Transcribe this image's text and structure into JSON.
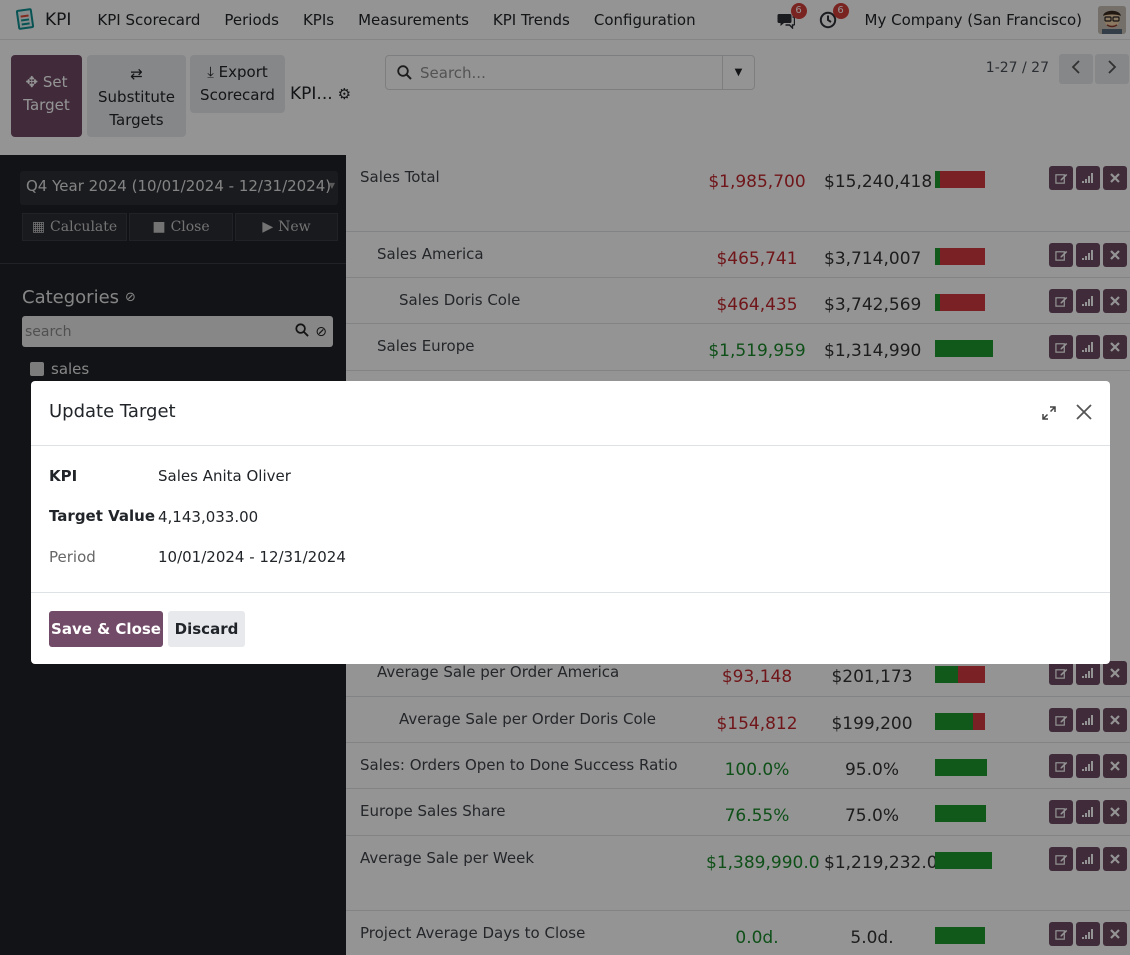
{
  "navbar": {
    "brand": "KPI",
    "menu": [
      "KPI Scorecard",
      "Periods",
      "KPIs",
      "Measurements",
      "KPI Trends",
      "Configuration"
    ],
    "messages_badge": "6",
    "activities_badge": "6",
    "company": "My Company (San Francisco)"
  },
  "control_panel": {
    "set_target_line1": "Set",
    "set_target_line2": "Target",
    "substitute_line1": "Substitute",
    "substitute_line2": "Targets",
    "export_line1": "Export",
    "export_line2": "Scorecard",
    "title": "KPI...",
    "search_placeholder": "Search...",
    "pager": "1-27 / 27"
  },
  "sidebar": {
    "period": "Q4 Year 2024 (10/01/2024 - 12/31/2024)",
    "actions": [
      "Calculate",
      "Close",
      "New"
    ],
    "categories_title": "Categories",
    "search_placeholder": "search",
    "category_items": [
      "sales"
    ]
  },
  "kpi_rows": [
    {
      "name": "Sales Total",
      "value": "$1,985,700",
      "target": "$15,240,418",
      "value_status": "red",
      "gauge_green": 0.1
    },
    {
      "name": "Sales America",
      "value": "$465,741",
      "target": "$3,714,007",
      "value_status": "red",
      "gauge_green": 0.1
    },
    {
      "name": "Sales Doris Cole",
      "value": "$464,435",
      "target": "$3,742,569",
      "value_status": "red",
      "gauge_green": 0.1
    },
    {
      "name": "Sales Europe",
      "value": "$1,519,959",
      "target": "$1,314,990",
      "value_status": "green",
      "gauge_green": 1.0
    },
    {
      "name": "Average Sale per Order America",
      "value": "$93,148",
      "target": "$201,173",
      "value_status": "red",
      "gauge_green": 0.45
    },
    {
      "name": "Average Sale per Order Doris Cole",
      "value": "$154,812",
      "target": "$199,200",
      "value_status": "red",
      "gauge_green": 0.75
    },
    {
      "name": "Sales: Orders Open to Done Success Ratio",
      "value": "100.0%",
      "target": "95.0%",
      "value_status": "green",
      "gauge_green": 1.0
    },
    {
      "name": "Europe Sales Share",
      "value": "76.55%",
      "target": "75.0%",
      "value_status": "green",
      "gauge_green": 1.0
    },
    {
      "name": "Average Sale per Week",
      "value": "$1,389,990.0",
      "target": "$1,219,232.0",
      "value_status": "green",
      "gauge_green": 1.0
    },
    {
      "name": "Project Average Days to Close",
      "value": "0.0d.",
      "target": "5.0d.",
      "value_status": "green",
      "gauge_green": 1.0
    }
  ],
  "modal": {
    "title": "Update Target",
    "kpi_label": "KPI",
    "kpi_value": "Sales Anita Oliver",
    "target_label": "Target Value",
    "target_value": "4,143,033.00",
    "period_label": "Period",
    "period_value": "10/01/2024 - 12/31/2024",
    "save_label": "Save & Close",
    "discard_label": "Discard"
  },
  "colors": {
    "primary": "#714b67",
    "danger": "#c1272d",
    "success": "#1a8a2c"
  }
}
